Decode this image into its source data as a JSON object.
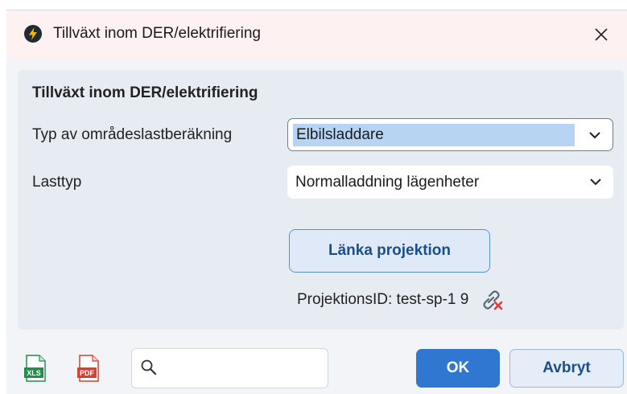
{
  "window": {
    "title": "Tillväxt inom DER/elektrifiering"
  },
  "panel": {
    "heading": "Tillväxt inom DER/elektrifiering",
    "fields": [
      {
        "label": "Typ av områdeslastberäkning",
        "value": "Elbilsladdare"
      },
      {
        "label": "Lasttyp",
        "value": "Normalladdning lägenheter"
      }
    ],
    "link_button_label": "Länka projektion",
    "projection_id_text": "ProjektionsID: test-sp-1 9"
  },
  "footer": {
    "xls_label": "XLS",
    "pdf_label": "PDF",
    "search_value": "",
    "ok_label": "OK",
    "cancel_label": "Avbryt"
  },
  "icons": {
    "app": "lightning-bolt-icon",
    "close": "close-icon",
    "chevron": "chevron-down-icon",
    "unlink": "unlink-icon",
    "xls": "excel-file-icon",
    "pdf": "pdf-file-icon",
    "search": "search-icon"
  },
  "colors": {
    "primary": "#2f77d1",
    "titlebar": "#fdf1f1",
    "selection": "#b8d4f5",
    "unlink_accent": "#e23b3b",
    "xls_green": "#1f8f4a",
    "pdf_red": "#d8402f"
  }
}
